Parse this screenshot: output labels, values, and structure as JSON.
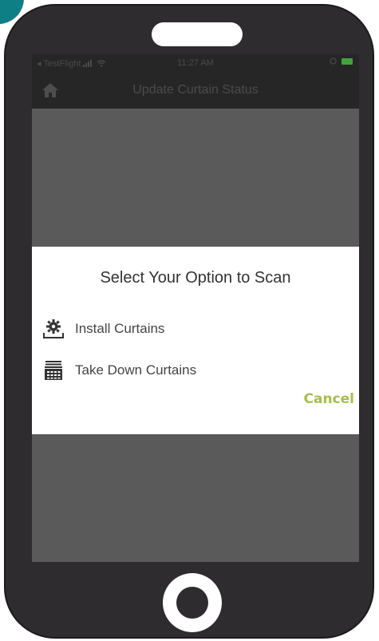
{
  "status_bar": {
    "carrier": "◂ TestFlight",
    "time": "11:27 AM"
  },
  "nav": {
    "title": "Update Curtain Status",
    "home_icon": "home-icon"
  },
  "dialog": {
    "title": "Select Your Option to Scan",
    "options": [
      {
        "label": "Install Curtains",
        "icon": "gear-tray-icon"
      },
      {
        "label": "Take Down Curtains",
        "icon": "curtain-box-icon"
      }
    ],
    "cancel_label": "Cancel"
  },
  "colors": {
    "phone_body": "#2f2c30",
    "screen_overlay": "#5a5a5a",
    "nav_bar": "#262626",
    "accent_cancel": "#a3c14a",
    "teal_corner": "#0f7f86"
  }
}
